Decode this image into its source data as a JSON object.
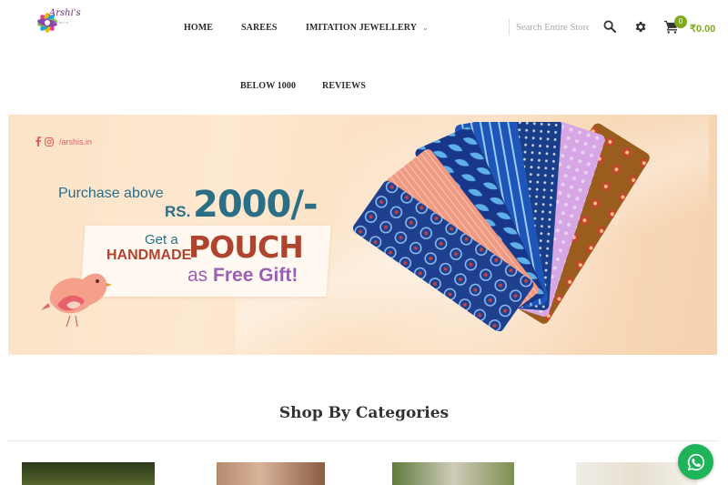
{
  "brand": {
    "logo_text": "Arshi's",
    "logo_tagline": "ARSHIS.IN"
  },
  "nav": {
    "row1": [
      {
        "label": "HOME"
      },
      {
        "label": "SAREES"
      },
      {
        "label": "IMITATION JEWELLERY",
        "has_dropdown": true
      }
    ],
    "row2": [
      {
        "label": "BELOW 1000"
      },
      {
        "label": "REVIEWS"
      }
    ]
  },
  "search": {
    "placeholder": "Search Entire Store Here..."
  },
  "cart": {
    "count": "0",
    "total": "₹0.00"
  },
  "icons": [
    "search-icon",
    "gear-icon",
    "cart-icon",
    "facebook-icon",
    "instagram-icon",
    "whatsapp-icon",
    "chevron-down-icon"
  ],
  "banner": {
    "social_handle": "/arshis.in",
    "line1": "Purchase above",
    "currency": "RS.",
    "amount": "2000/-",
    "get_a": "Get a",
    "handmade": "HANDMADE",
    "pouch": "POUCH",
    "as_free": "as",
    "free_gift": "Free Gift!"
  },
  "categories": {
    "title": "Shop By Categories"
  },
  "colors": {
    "accent_green": "#7fab1b",
    "banner_teal": "#2b6f86",
    "banner_red": "#b0452f",
    "banner_purple": "#9b5fb4",
    "whatsapp_green": "#1fb35a"
  }
}
